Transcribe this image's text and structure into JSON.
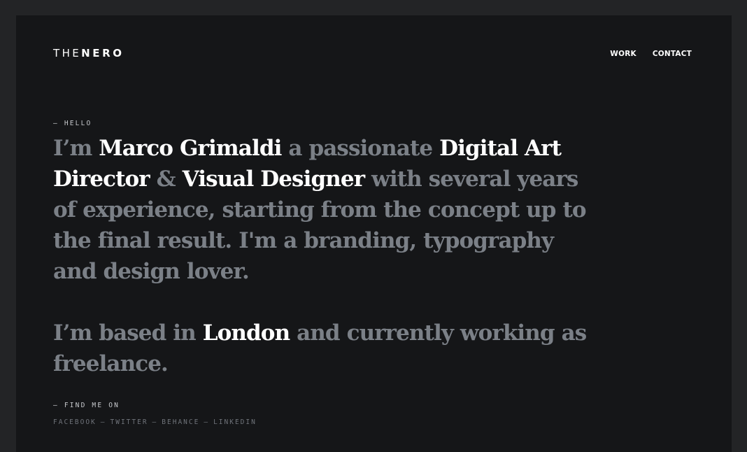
{
  "logo": {
    "light": "THE",
    "bold": "NERO"
  },
  "nav": {
    "work": "WORK",
    "contact": "CONTACT"
  },
  "hello_label": "— HELLO",
  "intro": {
    "p1": {
      "t1": "I’m ",
      "name": "Marco Grimaldi",
      "t2": " a passionate ",
      "role1": "Digital Art Director",
      "amp": " & ",
      "role2": "Visual Designer",
      "t3": " with several years of experience, starting from the concept up to the final result. I'm a branding, typography and design lover."
    },
    "p2": {
      "t1": "I’m based in ",
      "city": "London",
      "t2": " and currently working as freelance."
    }
  },
  "find_label": "— FIND ME ON",
  "social": {
    "facebook": "FACEBOOK",
    "twitter": "TWITTER",
    "behance": "BEHANCE",
    "linkedin": "LINKEDIN",
    "separator": "—"
  },
  "colors": {
    "background": "#232426",
    "panel": "#151618",
    "highlight": "#ffffff",
    "muted": "#7b8087"
  }
}
